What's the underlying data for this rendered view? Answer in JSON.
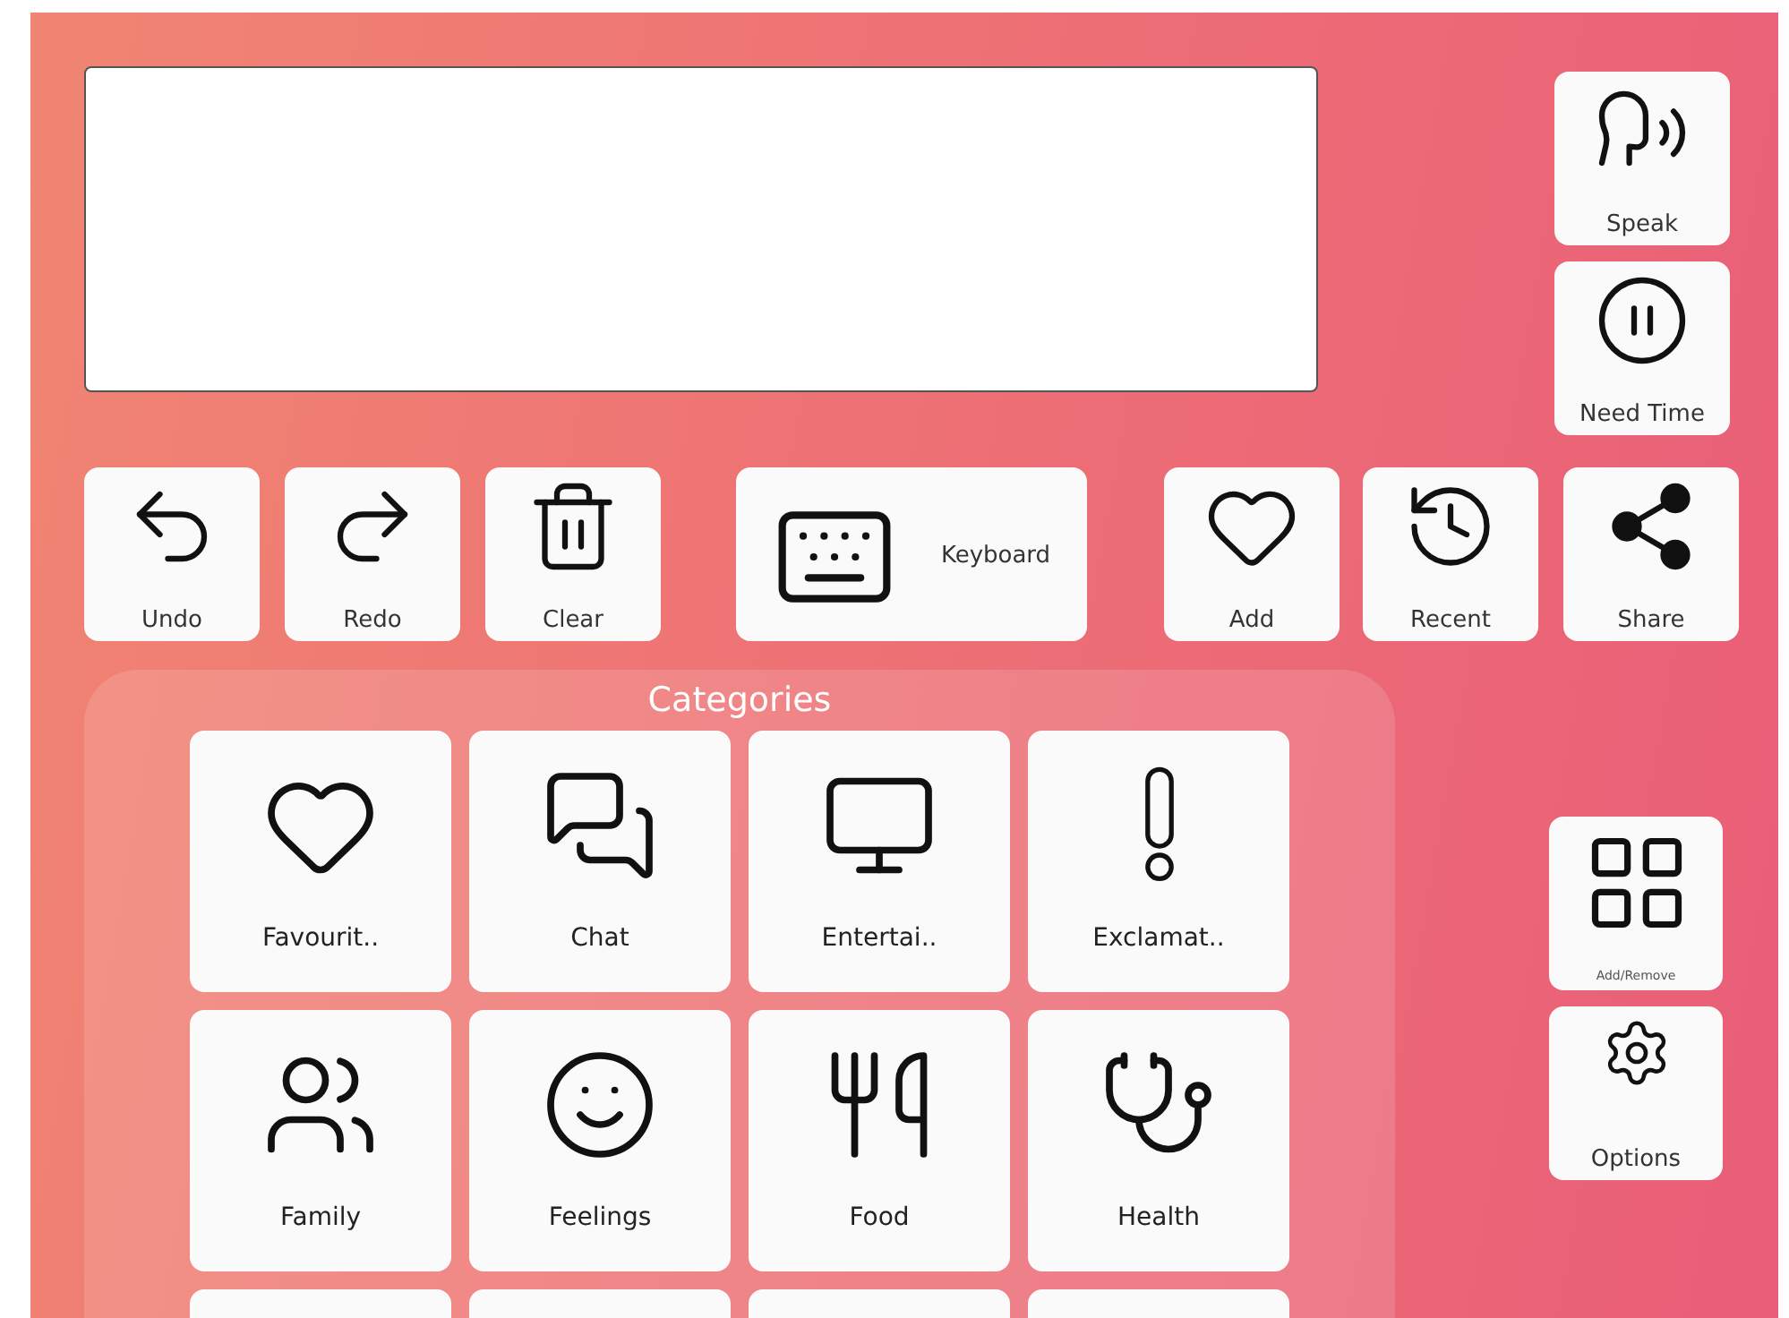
{
  "side_actions": [
    {
      "label": "Speak"
    },
    {
      "label": "Need Time"
    }
  ],
  "toolbar": [
    {
      "label": "Undo"
    },
    {
      "label": "Redo"
    },
    {
      "label": "Clear"
    },
    {
      "label": "Keyboard"
    },
    {
      "label": "Add"
    },
    {
      "label": "Recent"
    },
    {
      "label": "Share"
    }
  ],
  "categories": {
    "title": "Categories",
    "tiles": [
      {
        "kind": "tile",
        "label": "Favourit.."
      },
      {
        "kind": "tile",
        "label": "Chat"
      },
      {
        "kind": "tile",
        "label": "Entertai.."
      },
      {
        "kind": "tile",
        "label": "Exclamat.."
      },
      {
        "kind": "tile",
        "label": "Family"
      },
      {
        "kind": "tile",
        "label": "Feelings"
      },
      {
        "kind": "tile",
        "label": "Food"
      },
      {
        "kind": "tile",
        "label": "Health"
      },
      {
        "kind": "cut_off"
      },
      {
        "kind": "cut_off"
      },
      {
        "kind": "cut_off"
      },
      {
        "kind": "cut_off"
      }
    ]
  },
  "menu_actions": [
    {
      "label": "Add/Remove"
    },
    {
      "label": "Options"
    }
  ]
}
